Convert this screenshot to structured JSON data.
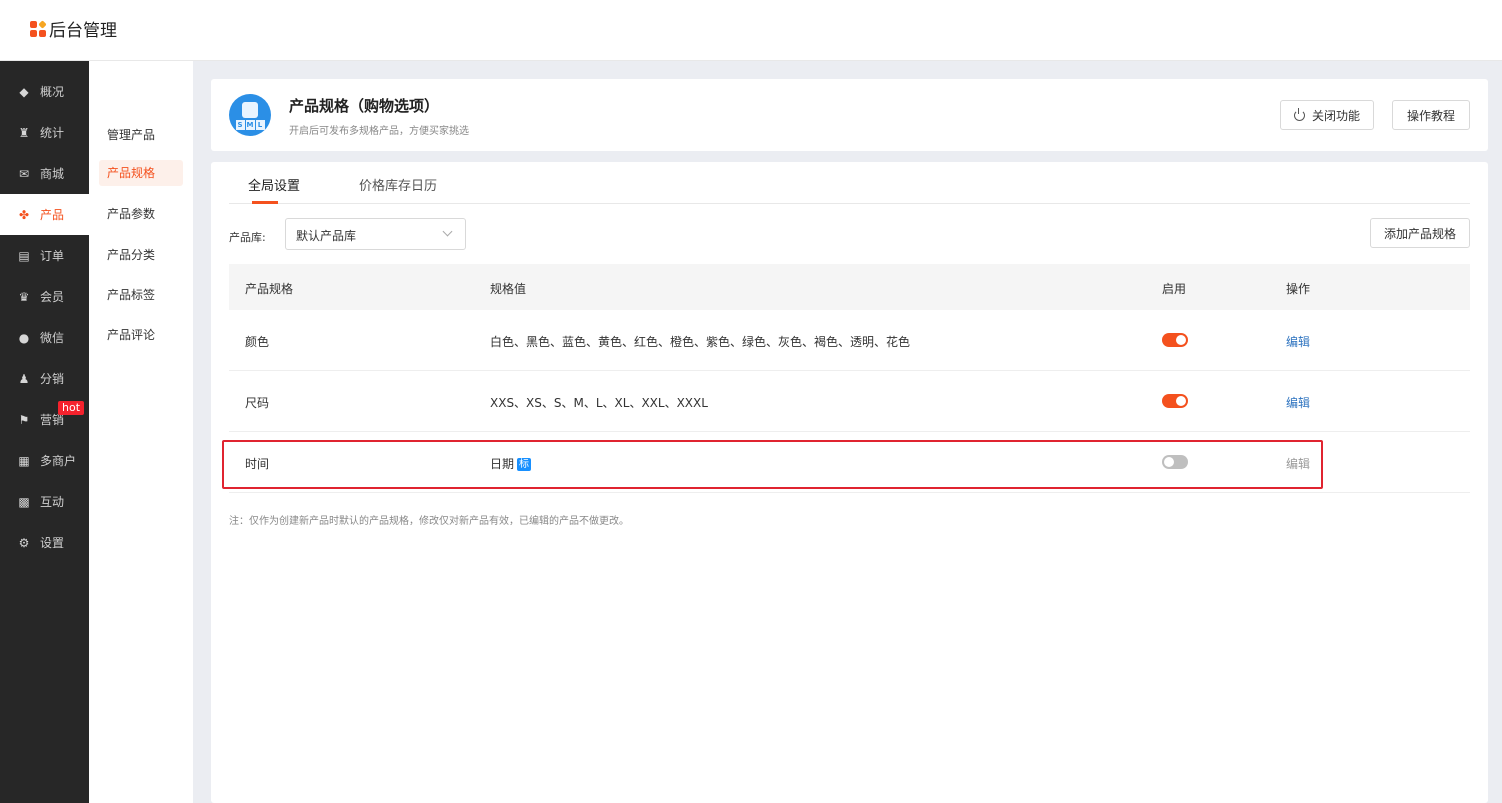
{
  "app": {
    "title": "后台管理"
  },
  "sidebar": {
    "items": [
      {
        "label": "概况",
        "icon": "◆"
      },
      {
        "label": "统计",
        "icon": "♜"
      },
      {
        "label": "商城",
        "icon": "✉"
      },
      {
        "label": "产品",
        "icon": "✤"
      },
      {
        "label": "订单",
        "icon": "▤"
      },
      {
        "label": "会员",
        "icon": "♛"
      },
      {
        "label": "微信",
        "icon": "●"
      },
      {
        "label": "分销",
        "icon": "♟"
      },
      {
        "label": "营销",
        "icon": "⚑",
        "badge": "hot"
      },
      {
        "label": "多商户",
        "icon": "▦"
      },
      {
        "label": "互动",
        "icon": "▩"
      },
      {
        "label": "设置",
        "icon": "⚙"
      }
    ]
  },
  "subnav": {
    "items": [
      "管理产品",
      "产品规格",
      "产品参数",
      "产品分类",
      "产品标签",
      "产品评论"
    ]
  },
  "header": {
    "title": "产品规格（购物选项）",
    "description": "开启后可发布多规格产品，方便买家挑选",
    "icon_letters": [
      "S",
      "M",
      "L"
    ],
    "close_button": "关闭功能",
    "tutorial_button": "操作教程"
  },
  "tabs": [
    "全局设置",
    "价格库存日历"
  ],
  "filter": {
    "label": "产品库:",
    "selected": "默认产品库"
  },
  "add_button": "添加产品规格",
  "table": {
    "headers": [
      "产品规格",
      "规格值",
      "启用",
      "操作"
    ],
    "rows": [
      {
        "name": "颜色",
        "values": "白色、黑色、蓝色、黄色、红色、橙色、紫色、绿色、灰色、褐色、透明、花色",
        "badge": "",
        "enabled": "on",
        "action": "编辑"
      },
      {
        "name": "尺码",
        "values": "XXS、XS、S、M、L、XL、XXL、XXXL",
        "badge": "",
        "enabled": "on",
        "action": "编辑"
      },
      {
        "name": "时间",
        "values": "日期",
        "badge": "标",
        "enabled": "off",
        "action": "编辑"
      }
    ]
  },
  "note": "注：仅作为创建新产品时默认的产品规格，修改仅对新产品有效，已编辑的产品不做更改。",
  "colors": {
    "accent": "#f4511e",
    "sidebar": "#272727",
    "link": "#2f74c0",
    "highlight": "#e02430"
  }
}
